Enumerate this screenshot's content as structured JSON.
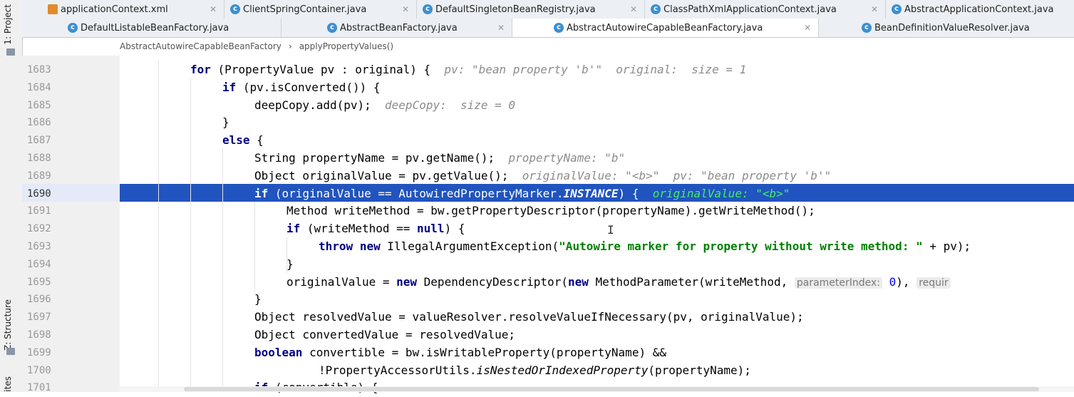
{
  "left_strip": {
    "project_tab": "1: Project",
    "structure_tab": "Z: Structure",
    "favorites_tab": "ites"
  },
  "tabs_row1": [
    {
      "label": "applicationContext.xml",
      "icon": "xml-file-icon",
      "active": false
    },
    {
      "label": "ClientSpringContainer.java",
      "icon": "class-icon",
      "active": false
    },
    {
      "label": "DefaultSingletonBeanRegistry.java",
      "icon": "class-icon",
      "active": false
    },
    {
      "label": "ClassPathXmlApplicationContext.java",
      "icon": "class-icon",
      "active": false
    },
    {
      "label": "AbstractApplicationContext.java",
      "icon": "class-icon",
      "active": false
    }
  ],
  "tabs_row2": [
    {
      "label": "DefaultListableBeanFactory.java",
      "icon": "class-icon",
      "active": false
    },
    {
      "label": "AbstractBeanFactory.java",
      "icon": "class-icon",
      "active": false
    },
    {
      "label": "AbstractAutowireCapableBeanFactory.java",
      "icon": "class-icon",
      "active": true
    },
    {
      "label": "BeanDefinitionValueResolver.java",
      "icon": "class-icon",
      "active": false
    }
  ],
  "breadcrumb": {
    "class": "AbstractAutowireCapableBeanFactory",
    "separator": "›",
    "method": "applyPropertyValues()"
  },
  "editor": {
    "highlighted_line": "1690",
    "lines": [
      {
        "num": "1683"
      },
      {
        "num": "1684"
      },
      {
        "num": "1685"
      },
      {
        "num": "1686"
      },
      {
        "num": "1687"
      },
      {
        "num": "1688"
      },
      {
        "num": "1689"
      },
      {
        "num": "1690"
      },
      {
        "num": "1691"
      },
      {
        "num": "1692"
      },
      {
        "num": "1693"
      },
      {
        "num": "1694"
      },
      {
        "num": "1695"
      },
      {
        "num": "1696"
      },
      {
        "num": "1697"
      },
      {
        "num": "1698"
      },
      {
        "num": "1699"
      },
      {
        "num": "1700"
      },
      {
        "num": "1701"
      }
    ],
    "code": {
      "l1683": {
        "kw1": "for",
        "t1": " (PropertyValue pv : original) {  ",
        "hint": "pv: \"bean property 'b'\"  original:  size = 1"
      },
      "l1684": {
        "kw1": "if",
        "t1": " (pv.isConverted()) {"
      },
      "l1685": {
        "t1": "deepCopy.add(pv);  ",
        "hint": "deepCopy:  size = 0"
      },
      "l1686": {
        "t1": "}"
      },
      "l1687": {
        "kw1": "else",
        "t1": " {"
      },
      "l1688": {
        "t1": "String propertyName = pv.getName();  ",
        "hint": "propertyName: \"b\""
      },
      "l1689": {
        "t1": "Object originalValue = pv.getValue();  ",
        "hint": "originalValue: \"<b>\"  pv: \"bean property 'b'\""
      },
      "l1690": {
        "kw1": "if",
        "t1": " (originalValue == AutowiredPropertyMarker.",
        "it1": "INSTANCE",
        "t2": ") {  ",
        "hint": "originalValue: \"<b>\""
      },
      "l1691": {
        "t1": "Method writeMethod = bw.getPropertyDescriptor(propertyName).getWriteMethod();"
      },
      "l1692": {
        "kw1": "if",
        "t1": " (writeMethod == ",
        "kw2": "null",
        "t2": ") {"
      },
      "l1693": {
        "kw1": "throw",
        "t0": " ",
        "kw2": "new",
        "t1": " IllegalArgumentException(",
        "str": "\"Autowire marker for property without write method: \"",
        "t2": " + pv);"
      },
      "l1694": {
        "t1": "}"
      },
      "l1695": {
        "t1": "originalValue = ",
        "kw1": "new",
        "t2": " DependencyDescriptor(",
        "kw2": "new",
        "t3": " MethodParameter(writeMethod, ",
        "inlay1": "parameterIndex:",
        "num": " 0",
        "t4": "), ",
        "inlay2": "requir"
      },
      "l1696": {
        "t1": "}"
      },
      "l1697": {
        "t1": "Object resolvedValue = valueResolver.resolveValueIfNecessary(pv, originalValue);"
      },
      "l1698": {
        "t1": "Object convertedValue = resolvedValue;"
      },
      "l1699": {
        "kw1": "boolean",
        "t1": " convertible = bw.isWritableProperty(propertyName) &&"
      },
      "l1700": {
        "t1": "!PropertyAccessorUtils.",
        "it1": "isNestedOrIndexedProperty",
        "t2": "(propertyName);"
      },
      "l1701": {
        "kw1": "if",
        "t1": " (convertible) {"
      }
    }
  },
  "colors": {
    "highlight_row": "#2154be",
    "keyword": "#000080",
    "string": "#008000",
    "hint": "#8c8c8c"
  }
}
